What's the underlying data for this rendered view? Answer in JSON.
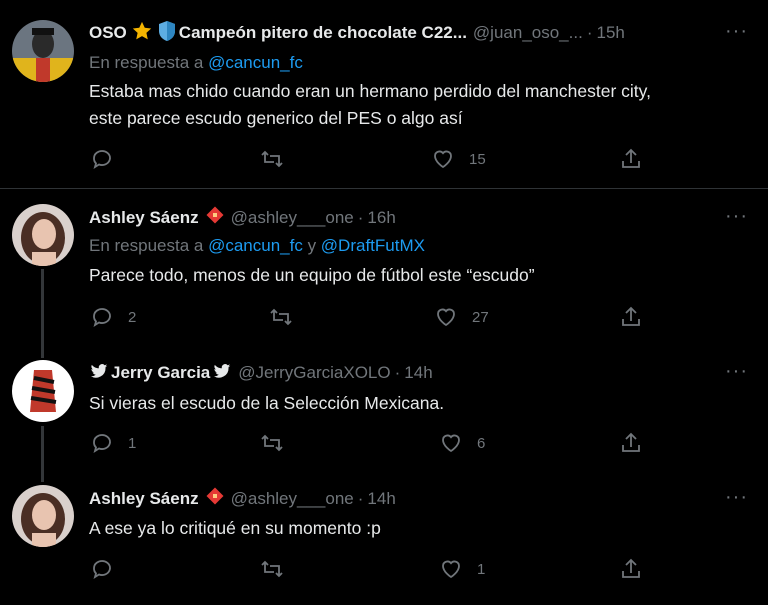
{
  "tweets": [
    {
      "name": "OSO",
      "name_suffix": "Campeón pitero de chocolate C22...",
      "handle": "@juan_oso_...",
      "time": "15h",
      "replying_prefix": "En respuesta a ",
      "replying_to_1": "@cancun_fc",
      "replying_join": "",
      "replying_to_2": "",
      "text_line1": "Estaba mas chido cuando eran un hermano perdido del manchester city,",
      "text_line2": "este parece escudo generico del PES o algo así",
      "replies": "",
      "retweets": "",
      "likes": "15"
    },
    {
      "name": "Ashley Sáenz",
      "handle": "@ashley___one",
      "time": "16h",
      "replying_prefix": "En respuesta a ",
      "replying_to_1": "@cancun_fc",
      "replying_join": " y ",
      "replying_to_2": "@DraftFutMX",
      "text_line1": "Parece todo, menos de un equipo de fútbol este “escudo”",
      "replies": "2",
      "retweets": "",
      "likes": "27"
    },
    {
      "name": "Jerry Garcia",
      "handle": "@JerryGarciaXOLO",
      "time": "14h",
      "text_line1": "Si vieras el escudo de la Selección Mexicana.",
      "replies": "1",
      "retweets": "",
      "likes": "6"
    },
    {
      "name": "Ashley Sáenz",
      "handle": "@ashley___one",
      "time": "14h",
      "text_line1": "A ese ya lo critiqué en su momento :p",
      "replies": "",
      "retweets": "",
      "likes": "1"
    }
  ],
  "separator": "·",
  "more_label": "···",
  "colors": {
    "background": "#000000",
    "text": "#e7e9ea",
    "muted": "#71767b",
    "link": "#1d9bf0",
    "divider": "#2f3336"
  }
}
